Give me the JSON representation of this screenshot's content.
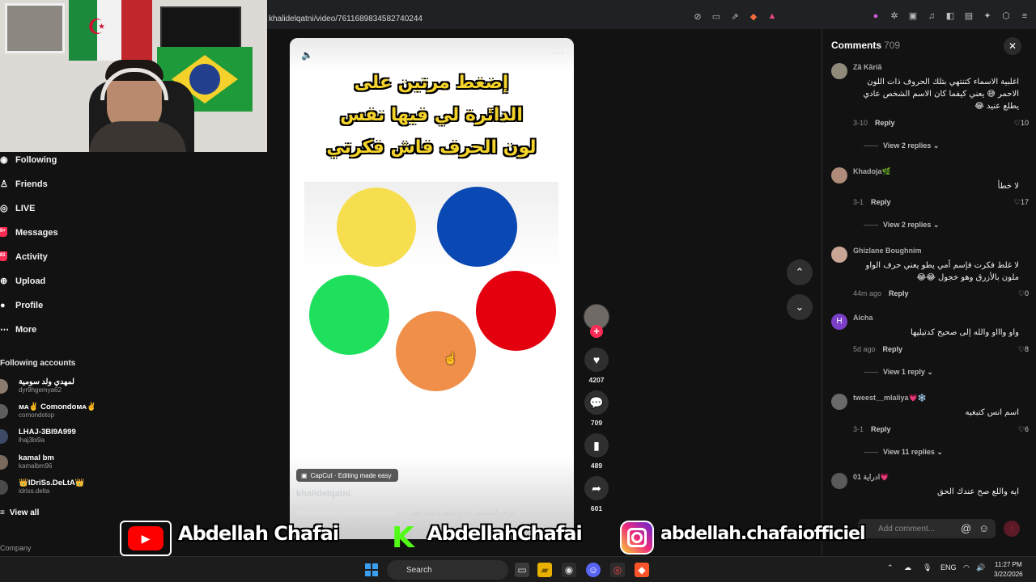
{
  "browser": {
    "url": "khalidelqatni/video/7611689834582740244"
  },
  "sidebar": {
    "nav": [
      {
        "label": "Following",
        "icon": "following-icon"
      },
      {
        "label": "Friends",
        "icon": "friends-icon"
      },
      {
        "label": "LIVE",
        "icon": "live-icon"
      },
      {
        "label": "Messages",
        "icon": "messages-icon",
        "badge": "9+"
      },
      {
        "label": "Activity",
        "icon": "activity-icon",
        "badge": "81"
      },
      {
        "label": "Upload",
        "icon": "upload-icon"
      },
      {
        "label": "Profile",
        "icon": "profile-icon"
      },
      {
        "label": "More",
        "icon": "more-icon"
      }
    ],
    "following_title": "Following accounts",
    "accounts": [
      {
        "name": "لمهدي ولد سومية",
        "handle": "dyr9hgemya62"
      },
      {
        "name": "ᴍᴀ✌ Comondoᴍᴀ✌",
        "handle": "comondotop"
      },
      {
        "name": "LHAJ-3BI9A999",
        "handle": "lhaj3bi9a"
      },
      {
        "name": "kamal bm",
        "handle": "kamalbm96"
      },
      {
        "name": "👑IDriSs.DeLtA👑",
        "handle": "idriss.delta"
      }
    ],
    "view_all": "View all",
    "company": "Company"
  },
  "video": {
    "title_lines": [
      "إضغط مرتين على",
      "الدائرة لي فيها نفس",
      "لون الحرف فاش فكرتي"
    ],
    "circles": [
      {
        "color": "#f6de4f"
      },
      {
        "color": "#0a49b3"
      },
      {
        "color": "#1fe05c"
      },
      {
        "color": "#e4000f"
      },
      {
        "color": "#ef8f4a"
      }
    ],
    "capcut_label": "CapCut · Editing made easy",
    "author": "khalidelqatni",
    "caption_text": "أعرف الشخص الذي تحبه وتفكر فيه",
    "caption_tags": "#foryoupag #magicienmaroc"
  },
  "actions": {
    "likes": "4207",
    "comments": "709",
    "saves": "489",
    "shares": "601"
  },
  "comments": {
    "title": "Comments",
    "count": "709",
    "add_placeholder": "Add comment...",
    "items": [
      {
        "name": "Zã Kãriã",
        "text": "اغلبية الاسماء كتنتهي بتلك الحروف ذات اللون الاحمر 😅 يعني كيفما كان الاسم الشخص عادي يطلع عنيد 😂",
        "date": "3-10",
        "reply": "Reply",
        "likes": "10",
        "replies": "View 2 replies"
      },
      {
        "name": "Khadoja🌿",
        "text": "لا خطأ",
        "date": "3-1",
        "reply": "Reply",
        "likes": "17",
        "replies": "View 2 replies"
      },
      {
        "name": "Ghizlane Boughnim",
        "text": "لا غلط فكرت فإسم أمي يطو يعني حرف الواو ملون بالأزرق وهو خجول 😂😂",
        "date": "44m ago",
        "reply": "Reply",
        "likes": "0",
        "replies": ""
      },
      {
        "name": "Aicha",
        "text": "واو واااو والله إلى صحيح كدتيليها",
        "date": "5d ago",
        "reply": "Reply",
        "likes": "8",
        "replies": "View 1 reply"
      },
      {
        "name": "tweest__mlaliya💗❄️",
        "text": "اسم انس كتبغيه",
        "date": "3-1",
        "reply": "Reply",
        "likes": "6",
        "replies": "View 11 replies"
      },
      {
        "name": "01 ادراية💗",
        "text": "ايه واللع صح عندك الحق",
        "date": "",
        "reply": "",
        "likes": "",
        "replies": ""
      }
    ]
  },
  "banner": {
    "youtube": "Abdellah Chafai",
    "kick": "AbdellahChafai",
    "instagram": "abdellah.chafaiofficiel"
  },
  "taskbar": {
    "search": "Search",
    "lang": "ENG",
    "time": "11:27 PM",
    "date": "3/22/2026"
  }
}
